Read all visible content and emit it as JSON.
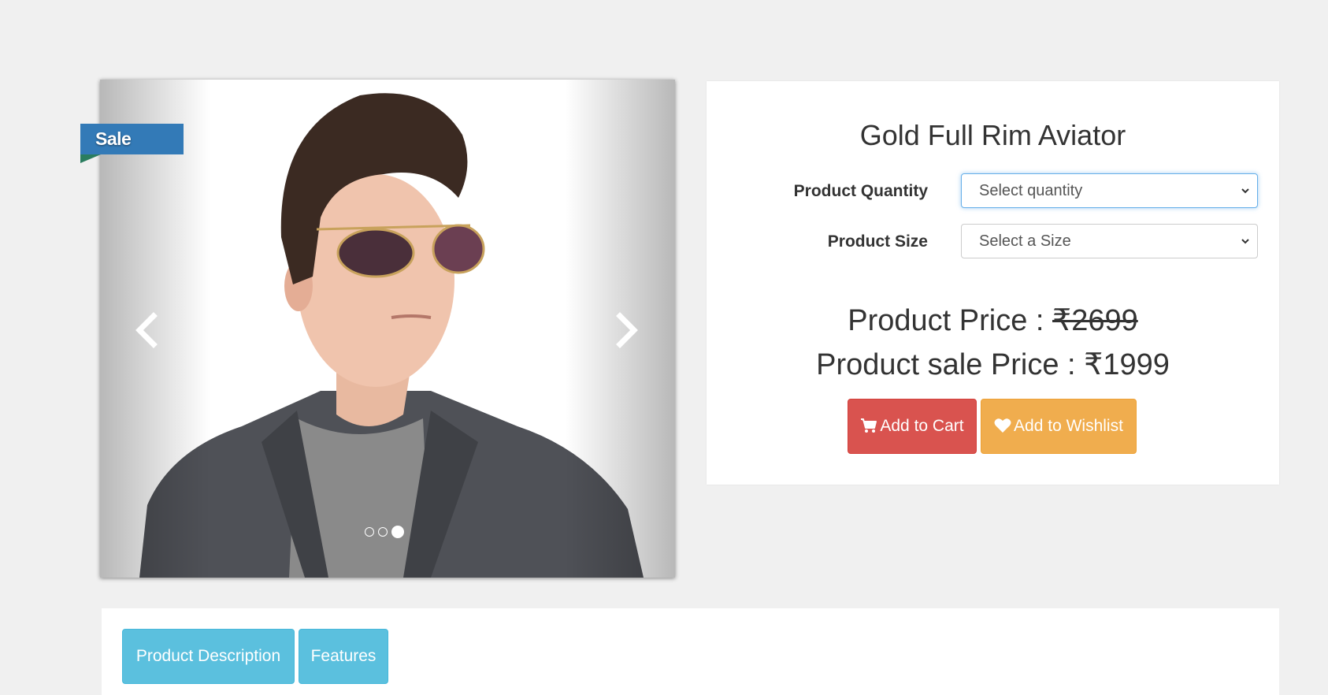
{
  "carousel": {
    "prev_icon": "chevron-left-icon",
    "next_icon": "chevron-right-icon",
    "slide_count": 3,
    "active_slide": 3,
    "badge": "Sale"
  },
  "product": {
    "title": "Gold Full Rim Aviator",
    "quantity_label": "Product Quantity",
    "quantity_value": "Select quantity",
    "size_label": "Product Size",
    "size_value": "Select a Size",
    "price_prefix": "Product Price : ",
    "price": "₹2699",
    "sale_price_prefix": "Product sale Price : ",
    "sale_price": "₹1999"
  },
  "actions": {
    "cart_label": "Add to Cart",
    "cart_icon": "shopping-cart-icon",
    "wishlist_label": "Add to Wishlist",
    "wishlist_icon": "heart-icon"
  },
  "tabs": [
    {
      "label": "Product Description"
    },
    {
      "label": "Features"
    }
  ],
  "colors": {
    "sale_badge": "#337ab7",
    "cart_button": "#d9534f",
    "wishlist_button": "#f0ad4e",
    "tab_button": "#5bc0de"
  }
}
